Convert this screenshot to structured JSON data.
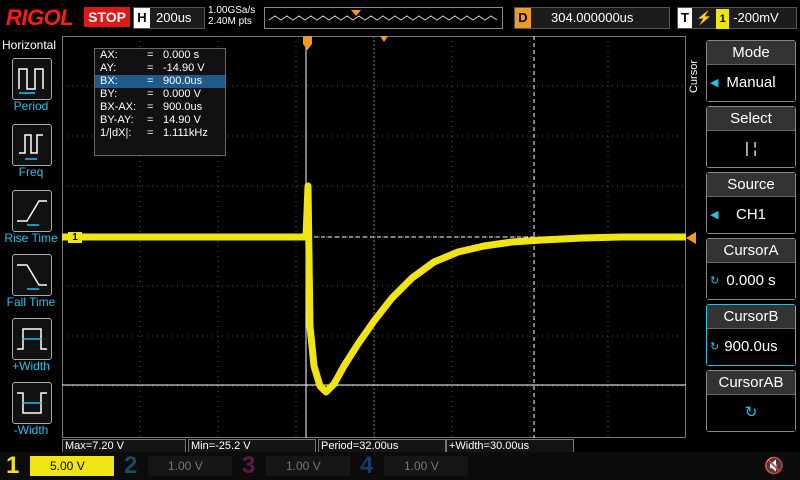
{
  "brand": "RIGOL",
  "run_state": "STOP",
  "timebase": {
    "key": "H",
    "value": "200us"
  },
  "sample": {
    "rate": "1.00GSa/s",
    "points": "2.40M pts"
  },
  "delay": {
    "key": "D",
    "value": "304.000000us"
  },
  "trigger": {
    "key": "T",
    "edge_icon": "falling-edge-icon",
    "channel": "1",
    "level": "-200mV"
  },
  "left_panel": {
    "title": "Horizontal",
    "items": [
      {
        "label": "Period",
        "icon": "period-icon"
      },
      {
        "label": "Freq",
        "icon": "freq-icon"
      },
      {
        "label": "Rise Time",
        "icon": "rise-time-icon"
      },
      {
        "label": "Fall Time",
        "icon": "fall-time-icon"
      },
      {
        "label": "+Width",
        "icon": "pos-width-icon"
      },
      {
        "label": "-Width",
        "icon": "neg-width-icon"
      }
    ]
  },
  "cursor_info": {
    "rows": [
      {
        "name": "AX:",
        "value": "0.000 s"
      },
      {
        "name": "AY:",
        "value": "-14.90 V"
      },
      {
        "name": "BX:",
        "value": "900.0us"
      },
      {
        "name": "BY:",
        "value": "0.000 V"
      },
      {
        "name": "BX-AX:",
        "value": "900.0us"
      },
      {
        "name": "BY-AY:",
        "value": "14.90 V"
      },
      {
        "name": "1/|dX|:",
        "value": "1.111kHz"
      }
    ]
  },
  "right_panel": {
    "side_label": "Cursor",
    "mode": {
      "head": "Mode",
      "value": "Manual"
    },
    "select": {
      "head": "Select",
      "value": "|  ¦"
    },
    "source": {
      "head": "Source",
      "value": "CH1"
    },
    "cursor_a": {
      "head": "CursorA",
      "value": "0.000 s"
    },
    "cursor_b": {
      "head": "CursorB",
      "value": "900.0us"
    },
    "cursor_ab": {
      "head": "CursorAB",
      "value": "↻"
    }
  },
  "markers": {
    "ch1": "1"
  },
  "measurements": {
    "max": "Max=7.20 V",
    "min": "Min=-25.2 V",
    "period": "Period=32.00us",
    "width": "+Width=30.00us"
  },
  "channels": [
    {
      "num": "1",
      "scale": "5.00 V",
      "color": "#f0e414",
      "active": true
    },
    {
      "num": "2",
      "scale": "1.00 V",
      "color": "#1ec4f0",
      "active": false
    },
    {
      "num": "3",
      "scale": "1.00 V",
      "color": "#e040c0",
      "active": false
    },
    {
      "num": "4",
      "scale": "1.00 V",
      "color": "#2a7be0",
      "active": false
    }
  ],
  "colors": {
    "trace": "#f0e414",
    "accent": "#1ec4f0",
    "delay": "#f29a1e",
    "stop": "#e01818"
  }
}
